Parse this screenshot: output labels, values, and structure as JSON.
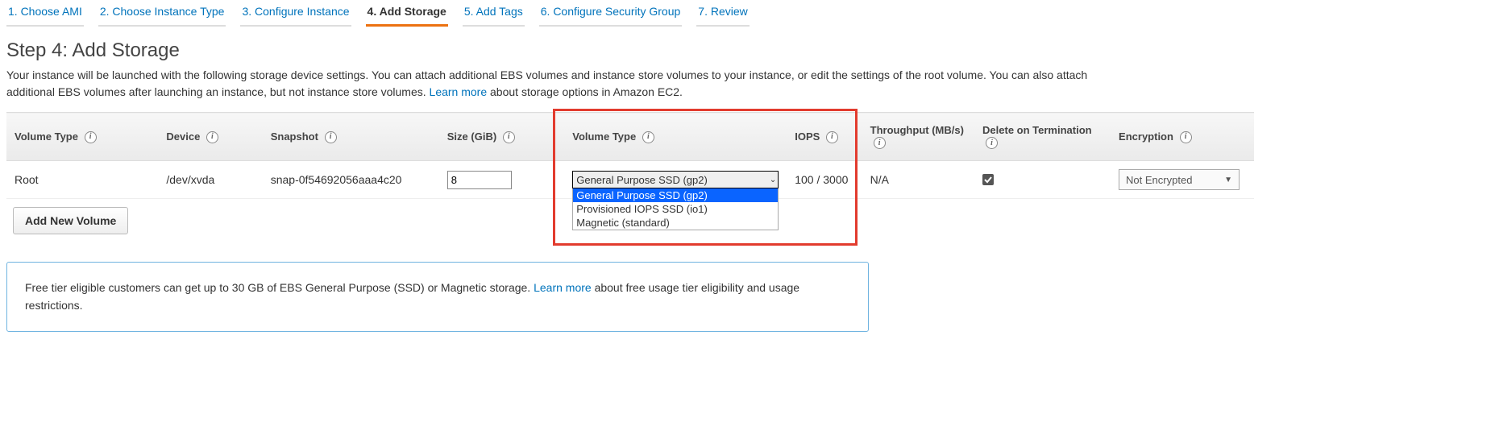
{
  "wizard": {
    "steps": [
      {
        "label": "1. Choose AMI"
      },
      {
        "label": "2. Choose Instance Type"
      },
      {
        "label": "3. Configure Instance"
      },
      {
        "label": "4. Add Storage"
      },
      {
        "label": "5. Add Tags"
      },
      {
        "label": "6. Configure Security Group"
      },
      {
        "label": "7. Review"
      }
    ],
    "active_index": 3
  },
  "page_title": "Step 4: Add Storage",
  "description": {
    "pre": "Your instance will be launched with the following storage device settings. You can attach additional EBS volumes and instance store volumes to your instance, or edit the settings of the root volume. You can also attach additional EBS volumes after launching an instance, but not instance store volumes. ",
    "link": "Learn more",
    "post": " about storage options in Amazon EC2."
  },
  "table": {
    "headers": {
      "vol_type_l": "Volume Type",
      "device": "Device",
      "snapshot": "Snapshot",
      "size": "Size (GiB)",
      "vol_type_r": "Volume Type",
      "iops": "IOPS",
      "throughput": "Throughput (MB/s)",
      "delete": "Delete on Termination",
      "encryption": "Encryption"
    },
    "row": {
      "vol_type_l": "Root",
      "device": "/dev/xvda",
      "snapshot": "snap-0f54692056aaa4c20",
      "size": "8",
      "vol_select_current": "General Purpose SSD (gp2)",
      "vol_select_options": [
        "General Purpose SSD (gp2)",
        "Provisioned IOPS SSD (io1)",
        "Magnetic (standard)"
      ],
      "iops": "100 / 3000",
      "throughput": "N/A",
      "delete_checked": true,
      "encryption": "Not Encrypted"
    }
  },
  "add_volume_label": "Add New Volume",
  "tier_notice": {
    "pre": "Free tier eligible customers can get up to 30 GB of EBS General Purpose (SSD) or Magnetic storage. ",
    "link": "Learn more",
    "post": " about free usage tier eligibility and usage restrictions."
  },
  "info_glyph": "i"
}
